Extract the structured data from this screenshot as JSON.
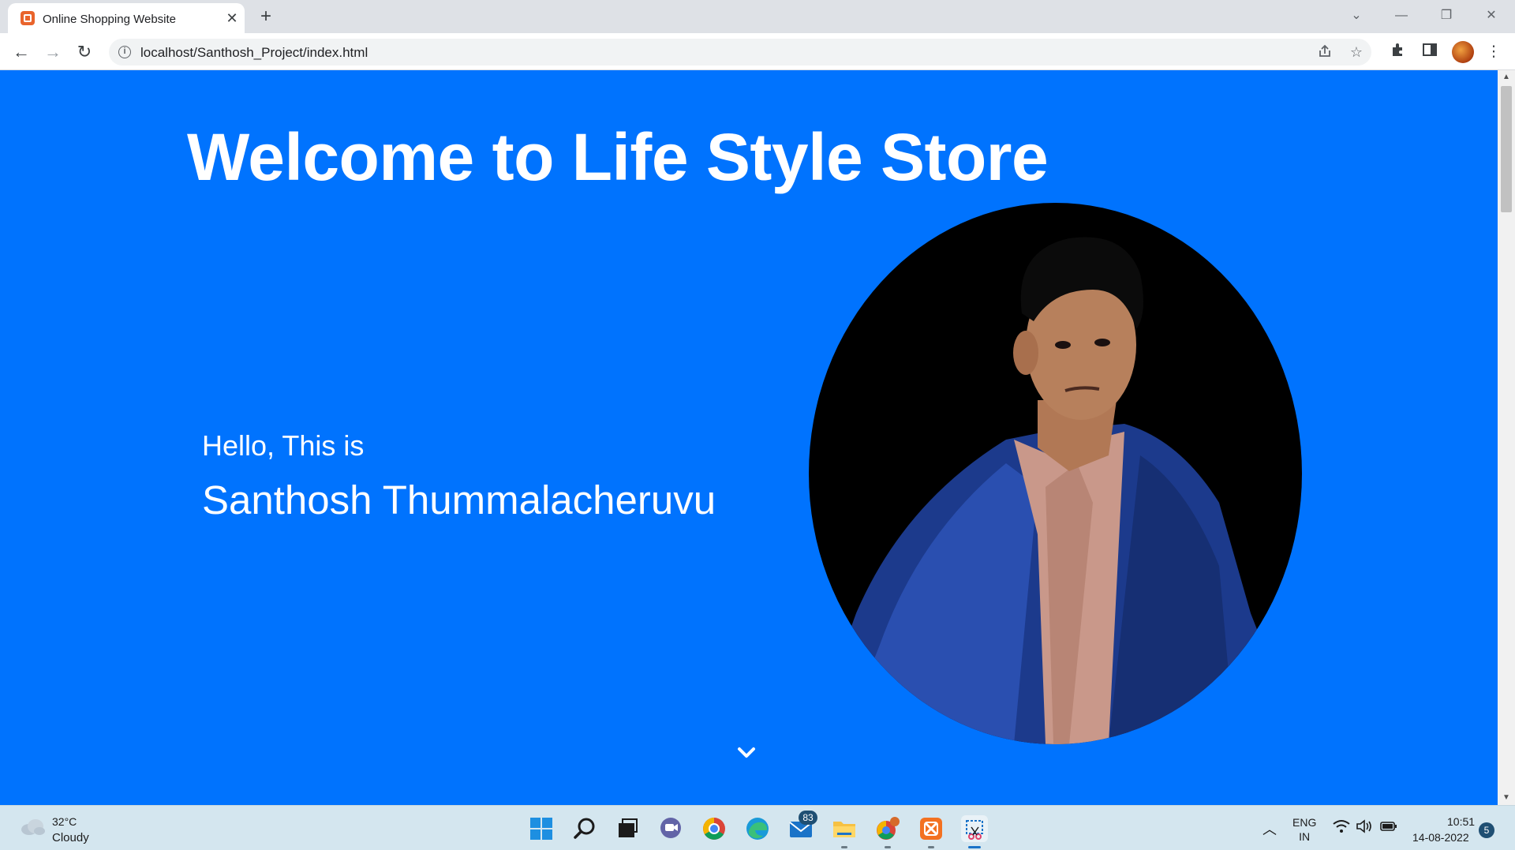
{
  "browser": {
    "tab_title": "Online Shopping Website",
    "tab_close": "✕",
    "new_tab": "+",
    "url": "localhost/Santhosh_Project/index.html",
    "window_controls": {
      "dropdown": "⌄",
      "minimize": "—",
      "restore": "❐",
      "close": "✕"
    },
    "nav": {
      "back": "←",
      "forward": "→",
      "reload": "↻"
    },
    "icons": [
      "info-icon",
      "share-icon",
      "star-icon",
      "extensions-icon",
      "side-panel-icon",
      "profile-avatar",
      "menu-icon"
    ]
  },
  "page": {
    "heading": "Welcome to Life Style Store",
    "greeting": "Hello, This is",
    "name": "Santhosh Thummalacheruvu",
    "accent_color": "#0073fe",
    "photo_description_icon": "profile-photo",
    "scroll_icon": "chevron-down-icon"
  },
  "taskbar": {
    "weather_temp": "32°C",
    "weather_desc": "Cloudy",
    "mail_badge": "83",
    "lang_line1": "ENG",
    "lang_line2": "IN",
    "time": "10:51",
    "date": "14-08-2022",
    "notification_count": "5",
    "apps": [
      "start-icon",
      "search-icon",
      "task-view-icon",
      "chat-icon",
      "chrome-icon",
      "edge-icon",
      "mail-icon",
      "file-explorer-icon",
      "chrome-profile-icon",
      "xampp-icon",
      "snipping-tool-icon"
    ]
  }
}
